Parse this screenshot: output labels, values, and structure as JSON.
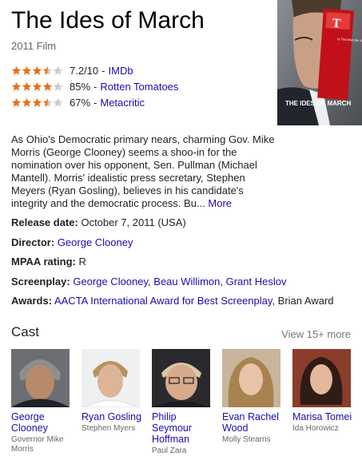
{
  "film": {
    "title": "The Ides of March",
    "subtitle": "2011 Film"
  },
  "ratings": [
    {
      "stars": 3.5,
      "value": "7.2/10",
      "separator": "-",
      "source": "IMDb"
    },
    {
      "stars": 4,
      "value": "85%",
      "separator": "-",
      "source": "Rotten Tomatoes"
    },
    {
      "stars": 3.5,
      "value": "67%",
      "separator": "-",
      "source": "Metacritic"
    }
  ],
  "poster": {
    "tagline": "Is This Man the Next President?",
    "caption": "THE IDES OF MARCH"
  },
  "description": {
    "text": "As Ohio's Democratic primary nears, charming Gov. Mike Morris (George Clooney) seems a shoo-in for the nomination over his opponent, Sen. Pullman (Michael Mantell). Morris' idealistic press secretary, Stephen Meyers (Ryan Gosling), believes in his candidate's integrity and the democratic process. Bu...",
    "more_label": "More"
  },
  "facts": {
    "release": {
      "label": "Release date:",
      "value": "October 7, 2011 (USA)"
    },
    "director": {
      "label": "Director:",
      "value": "George Clooney"
    },
    "mpaa": {
      "label": "MPAA rating:",
      "value": "R"
    },
    "screenplay": {
      "label": "Screenplay:",
      "names": [
        "George Clooney",
        "Beau Willimon",
        "Grant Heslov"
      ]
    },
    "awards": {
      "label": "Awards:",
      "link": "AACTA International Award for Best Screenplay",
      "sep": ",",
      "extra": "Brian Award"
    }
  },
  "cast": {
    "title": "Cast",
    "more_label": "View 15+ more",
    "members": [
      {
        "name": "George Clooney",
        "role": "Governor Mike Morris"
      },
      {
        "name": "Ryan Gosling",
        "role": "Stephen Myers"
      },
      {
        "name": "Philip Seymour Hoffman",
        "role": "Paul Zara"
      },
      {
        "name": "Evan Rachel Wood",
        "role": "Molly Stearns"
      },
      {
        "name": "Marisa Tomei",
        "role": "Ida Horowicz"
      }
    ]
  },
  "colors": {
    "link": "#1a0dab",
    "star_filled": "#e7711b",
    "star_empty": "#cccccc"
  }
}
